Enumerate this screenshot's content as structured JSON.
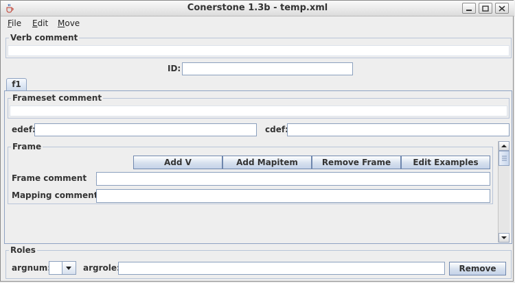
{
  "window": {
    "title": "Conerstone 1.3b - temp.xml",
    "icons": {
      "app": "java-cup-icon",
      "minimize": "minimize-icon",
      "maximize": "maximize-icon",
      "close": "close-icon"
    }
  },
  "menubar": {
    "items": [
      {
        "first": "F",
        "rest": "ile"
      },
      {
        "first": "E",
        "rest": "dit"
      },
      {
        "first": "M",
        "rest": "ove"
      }
    ]
  },
  "verb": {
    "comment_label": "Verb comment",
    "comment_value": "",
    "id_label": "ID:",
    "id_value": ""
  },
  "tabs": [
    {
      "label": "f1"
    }
  ],
  "frameset": {
    "comment_label": "Frameset comment",
    "comment_value": "",
    "edef_label": "edef:",
    "edef_value": "",
    "cdef_label": "cdef:",
    "cdef_value": ""
  },
  "frame": {
    "label": "Frame",
    "buttons": {
      "add_v": "Add V",
      "add_mapitem": "Add Mapitem",
      "remove_frame": "Remove Frame",
      "edit_examples": "Edit Examples"
    },
    "comment_label": "Frame comment   :",
    "comment_value": "",
    "mapping_label": "Mapping comment:",
    "mapping_value": ""
  },
  "roles": {
    "label": "Roles",
    "argnum_label": "argnum:",
    "argnum_value": "",
    "argrole_label": "argrole:",
    "argrole_value": "",
    "remove_label": "Remove"
  },
  "colors": {
    "border_blue": "#8ea2c2",
    "button_border": "#6e86ad",
    "background": "#eeeeee"
  }
}
